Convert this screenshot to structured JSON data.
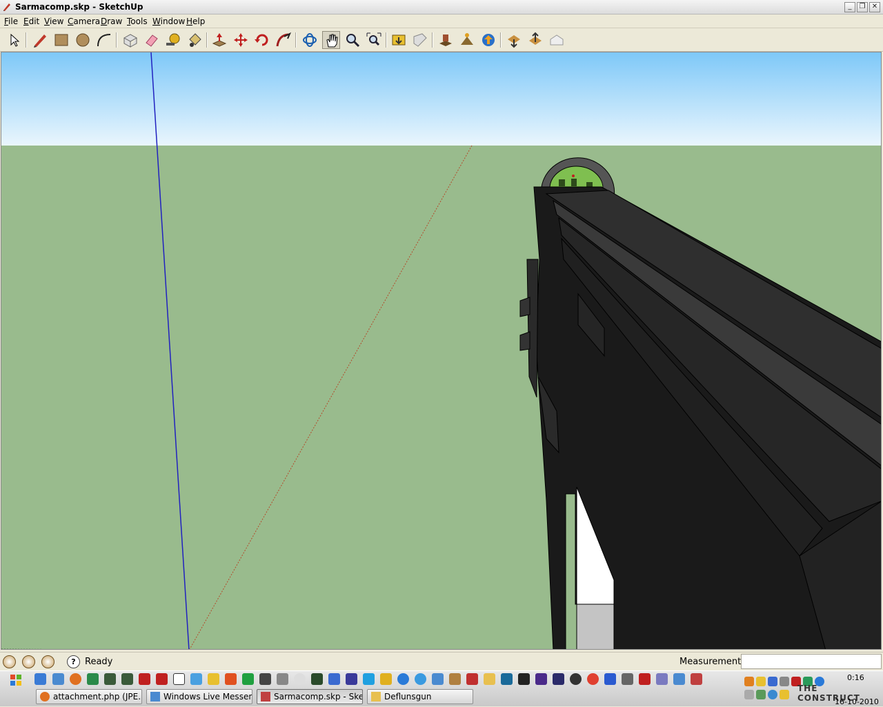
{
  "window": {
    "title": "Sarmacomp.skp - SketchUp"
  },
  "menu": [
    "File",
    "Edit",
    "View",
    "Camera",
    "Draw",
    "Tools",
    "Window",
    "Help"
  ],
  "toolbar": {
    "tools": [
      {
        "name": "select-tool",
        "icon": "arrow-cursor-icon"
      },
      {
        "name": "line-tool",
        "icon": "pencil-icon"
      },
      {
        "name": "rectangle-tool",
        "icon": "rectangle-icon"
      },
      {
        "name": "circle-tool",
        "icon": "circle-icon"
      },
      {
        "name": "arc-tool",
        "icon": "arc-icon"
      },
      {
        "name": "make-component-tool",
        "icon": "component-icon"
      },
      {
        "name": "eraser-tool",
        "icon": "eraser-icon"
      },
      {
        "name": "tape-measure-tool",
        "icon": "tape-measure-icon"
      },
      {
        "name": "paint-bucket-tool",
        "icon": "paint-bucket-icon"
      },
      {
        "name": "push-pull-tool",
        "icon": "push-pull-icon"
      },
      {
        "name": "move-tool",
        "icon": "move-icon"
      },
      {
        "name": "rotate-tool",
        "icon": "rotate-icon"
      },
      {
        "name": "follow-me-tool",
        "icon": "follow-me-icon"
      },
      {
        "name": "orbit-tool",
        "icon": "orbit-icon"
      },
      {
        "name": "pan-tool",
        "icon": "hand-icon"
      },
      {
        "name": "zoom-tool",
        "icon": "magnifier-icon"
      },
      {
        "name": "zoom-extents-tool",
        "icon": "zoom-extents-icon"
      },
      {
        "name": "previous-view-tool",
        "icon": "previous-view-icon"
      },
      {
        "name": "next-view-tool",
        "icon": "next-view-icon"
      },
      {
        "name": "add-location-tool",
        "icon": "location-icon"
      },
      {
        "name": "toggle-terrain-tool",
        "icon": "terrain-icon"
      },
      {
        "name": "get-models-tool",
        "icon": "warehouse-icon"
      },
      {
        "name": "share-model-tool",
        "icon": "share-icon"
      },
      {
        "name": "share-component-tool",
        "icon": "share-component-icon"
      },
      {
        "name": "get-photo-texture-tool",
        "icon": "photo-texture-icon"
      }
    ]
  },
  "status": {
    "text": "Ready",
    "measurements_label": "Measurements",
    "measurements_value": ""
  },
  "taskbar": {
    "tasks": [
      {
        "label": "attachment.php (JPE...",
        "icon": "firefox-icon",
        "active": false
      },
      {
        "label": "Windows Live Messen...",
        "icon": "messenger-icon",
        "active": false
      },
      {
        "label": "Sarmacomp.skp - Ske...",
        "icon": "sketchup-icon",
        "active": true
      },
      {
        "label": "Deflunsgun",
        "icon": "folder-icon",
        "active": false
      }
    ],
    "tray": {
      "time": "0:16",
      "date": "16-10-2010",
      "brand": "THE CONSTRUCT"
    }
  },
  "colors": {
    "sky_top": "#7ec8f8",
    "sky_bottom": "#eaf6fd",
    "ground": "#99bb8d",
    "model": "#1e1e1e",
    "axis_blue": "#2020c0",
    "axis_red": "#b34a2a"
  }
}
